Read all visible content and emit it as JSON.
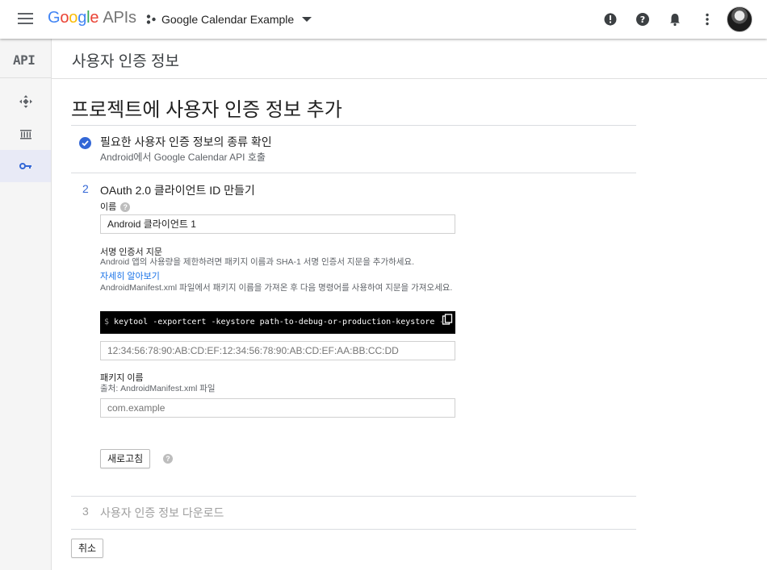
{
  "topbar": {
    "logo_google": [
      "G",
      "o",
      "o",
      "g",
      "l",
      "e"
    ],
    "logo_apis": "APIs",
    "project_name": "Google Calendar Example"
  },
  "rail": {
    "api_label": "API"
  },
  "header": {
    "title": "사용자 인증 정보"
  },
  "main": {
    "heading": "프로젝트에 사용자 인증 정보 추가",
    "step1": {
      "title": "필요한 사용자 인증 정보의 종류 확인",
      "subtitle": "Android에서 Google Calendar API 호출"
    },
    "step2": {
      "number": "2",
      "title": "OAuth 2.0 클라이언트 ID 만들기",
      "name_label": "이름",
      "name_value": "Android 클라이언트 1",
      "fingerprint_label": "서명 인증서 지문",
      "fingerprint_desc": "Android 앱의 사용량을 제한하려면 패키지 이름과 SHA-1 서명 인증서 지문을 추가하세요.",
      "learn_more": "자세히 알아보기",
      "manifest_desc": "AndroidManifest.xml 파일에서 패키지 이름을 가져온 후 다음 명령어를 사용하여 지문을 가져오세요.",
      "command_prompt": "$",
      "command": "keytool -exportcert -keystore path-to-debug-or-production-keystore -",
      "fingerprint_placeholder": "12:34:56:78:90:AB:CD:EF:12:34:56:78:90:AB:CD:EF:AA:BB:CC:DD",
      "package_label": "패키지 이름",
      "package_source": "출처: AndroidManifest.xml 파일",
      "package_placeholder": "com.example",
      "refresh_button": "새로고침"
    },
    "step3": {
      "number": "3",
      "title": "사용자 인증 정보 다운로드"
    },
    "cancel_button": "취소"
  },
  "colors": {
    "accent": "#3367d6",
    "link": "#1a73e8",
    "rail_active": "#e8eaf6"
  }
}
